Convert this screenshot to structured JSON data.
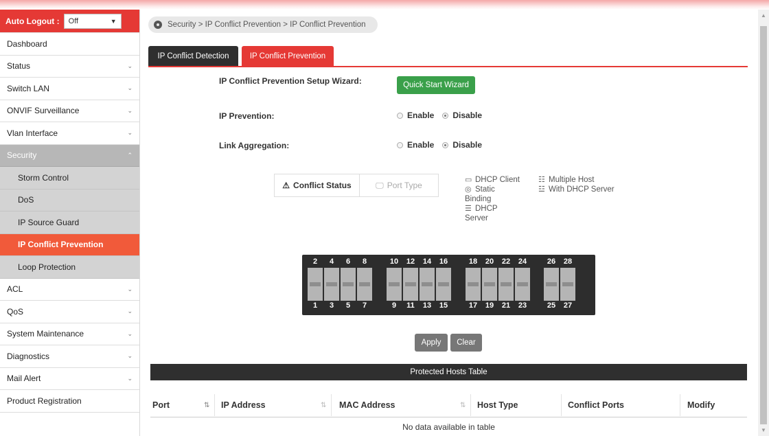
{
  "autologout": {
    "label": "Auto Logout :",
    "value": "Off"
  },
  "sidebar": {
    "items": [
      {
        "label": "Dashboard",
        "chev": false
      },
      {
        "label": "Status",
        "chev": true
      },
      {
        "label": "Switch LAN",
        "chev": true
      },
      {
        "label": "ONVIF Surveillance",
        "chev": true
      },
      {
        "label": "Vlan Interface",
        "chev": true
      }
    ],
    "security": "Security",
    "sub": [
      "Storm Control",
      "DoS",
      "IP Source Guard",
      "IP Conflict Prevention",
      "Loop Protection"
    ],
    "items2": [
      {
        "label": "ACL",
        "chev": true
      },
      {
        "label": "QoS",
        "chev": true
      },
      {
        "label": "System Maintenance",
        "chev": true
      },
      {
        "label": "Diagnostics",
        "chev": true
      },
      {
        "label": "Mail Alert",
        "chev": true
      },
      {
        "label": "Product Registration",
        "chev": false
      }
    ]
  },
  "breadcrumb": "Security > IP Conflict Prevention  > IP Conflict Prevention",
  "tabs": {
    "detection": "IP Conflict Detection",
    "prevention": "IP Conflict Prevention"
  },
  "form": {
    "wizard_label": "IP Conflict Prevention Setup Wizard:",
    "wizard_button": "Quick Start Wizard",
    "ip_prevention_label": "IP Prevention:",
    "link_aggregation_label": "Link Aggregation:",
    "enable": "Enable",
    "disable": "Disable"
  },
  "status": {
    "conflict_status": "Conflict Status",
    "port_type": "Port Type"
  },
  "legend": {
    "dhcp_client": "DHCP Client",
    "static_binding_1": "Static",
    "static_binding_2": "Binding",
    "dhcp_server_1": "DHCP",
    "dhcp_server_2": "Server",
    "multiple_host": "Multiple Host",
    "with_dhcp_server": "With DHCP Server"
  },
  "ports": {
    "top": [
      "2",
      "4",
      "6",
      "8",
      "10",
      "12",
      "14",
      "16",
      "18",
      "20",
      "22",
      "24",
      "26",
      "28"
    ],
    "bottom": [
      "1",
      "3",
      "5",
      "7",
      "9",
      "11",
      "13",
      "15",
      "17",
      "19",
      "21",
      "23",
      "25",
      "27"
    ]
  },
  "buttons": {
    "apply": "Apply",
    "clear": "Clear"
  },
  "table": {
    "title": "Protected Hosts Table",
    "columns": [
      "Port",
      "IP Address",
      "MAC Address",
      "Host Type",
      "Conflict Ports",
      "Modify"
    ],
    "empty": "No data available in table"
  },
  "colors": {
    "accent": "#e53935",
    "green": "#3aa04a",
    "active_sub": "#f15a3a",
    "dark": "#2f2f2f"
  }
}
